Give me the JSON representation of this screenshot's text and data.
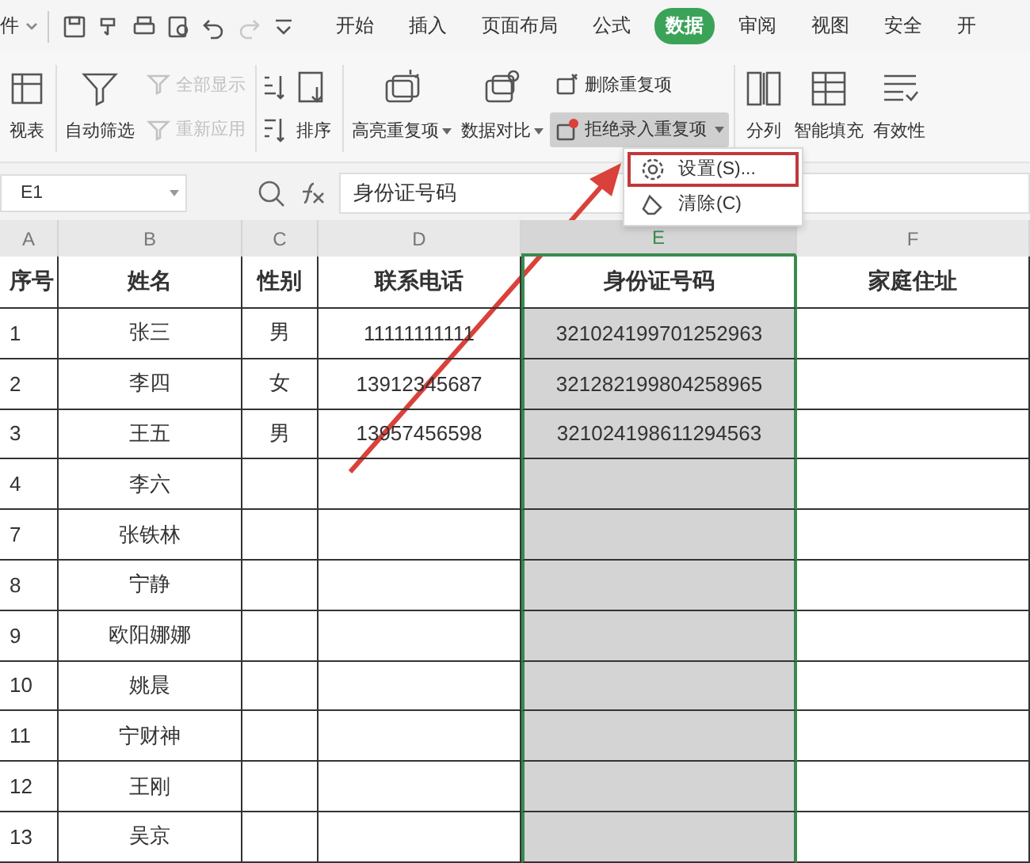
{
  "menubar": {
    "file_label": "件",
    "quick_access": [
      {
        "disabled": false
      },
      {
        "disabled": false
      },
      {
        "disabled": false
      },
      {
        "disabled": false
      },
      {
        "disabled": false
      },
      {
        "disabled": true
      },
      {
        "disabled": false
      }
    ],
    "tabs": [
      {
        "label": "开始",
        "selected": false
      },
      {
        "label": "插入",
        "selected": false
      },
      {
        "label": "页面布局",
        "selected": false
      },
      {
        "label": "公式",
        "selected": false
      },
      {
        "label": "数据",
        "selected": true
      },
      {
        "label": "审阅",
        "selected": false
      },
      {
        "label": "视图",
        "selected": false
      },
      {
        "label": "安全",
        "selected": false
      },
      {
        "label": "开",
        "selected": false
      }
    ]
  },
  "ribbon": {
    "groups": [
      {
        "items": [
          {
            "kind": "large",
            "label": "视表",
            "dropdown": false
          }
        ]
      },
      {
        "items": [
          {
            "kind": "large",
            "label": "自动筛选",
            "dropdown": false
          },
          {
            "kind": "column",
            "children": [
              {
                "label": "全部显示",
                "disabled": true,
                "active": false,
                "dropdown": false
              },
              {
                "label": "重新应用",
                "disabled": true,
                "active": false,
                "dropdown": false
              }
            ]
          }
        ]
      },
      {
        "items": [
          {
            "kind": "sort_icons"
          },
          {
            "kind": "large",
            "label": "排序",
            "dropdown": false
          }
        ]
      },
      {
        "items": [
          {
            "kind": "large",
            "label": "高亮重复项",
            "dropdown": true
          },
          {
            "kind": "large",
            "label": "数据对比",
            "dropdown": true
          },
          {
            "kind": "column",
            "children": [
              {
                "label": "删除重复项",
                "disabled": false,
                "active": false,
                "dropdown": false
              },
              {
                "label": "拒绝录入重复项",
                "disabled": false,
                "active": true,
                "dropdown": true
              }
            ]
          }
        ]
      },
      {
        "items": [
          {
            "kind": "large",
            "label": "分列",
            "dropdown": false
          },
          {
            "kind": "large",
            "label": "智能填充",
            "dropdown": false
          },
          {
            "kind": "large",
            "label": "有效性",
            "dropdown": false
          }
        ]
      }
    ]
  },
  "dropdown_menu": {
    "items": [
      {
        "label": "设置(S)...",
        "highlighted": true
      },
      {
        "label": "清除(C)",
        "highlighted": false
      }
    ]
  },
  "formula_bar": {
    "cell_ref": "E1",
    "formula": "身份证号码"
  },
  "sheet": {
    "columns": [
      {
        "label": "A",
        "selected": false
      },
      {
        "label": "B",
        "selected": false
      },
      {
        "label": "C",
        "selected": false
      },
      {
        "label": "D",
        "selected": false
      },
      {
        "label": "E",
        "selected": true
      },
      {
        "label": "F",
        "selected": false
      }
    ],
    "header_row": [
      "序号",
      "姓名",
      "性别",
      "联系电话",
      "身份证号码",
      "家庭住址"
    ],
    "rows": [
      [
        "1",
        "张三",
        "男",
        "11111111111",
        "321024199701252963"
      ],
      [
        "2",
        "李四",
        "女",
        "13912345687",
        "321282199804258965"
      ],
      [
        "3",
        "王五",
        "男",
        "13957456598",
        "321024198611294563"
      ],
      [
        "4",
        "李六"
      ],
      [
        "7",
        "张铁林"
      ],
      [
        "8",
        "宁静"
      ],
      [
        "9",
        "欧阳娜娜"
      ],
      [
        "10",
        "姚晨"
      ],
      [
        "11",
        "宁财神"
      ],
      [
        "12",
        "王刚"
      ],
      [
        "13",
        "吴京"
      ]
    ]
  }
}
